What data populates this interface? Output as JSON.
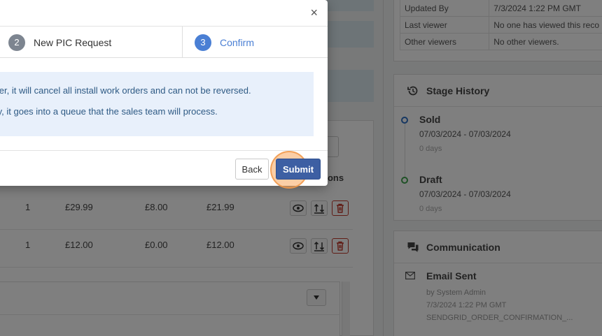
{
  "meta": {
    "rows": [
      {
        "key": "Updated By",
        "value": "7/3/2024 1:22 PM GMT"
      },
      {
        "key": "Last viewer",
        "value": "No one has viewed this reco"
      },
      {
        "key": "Other viewers",
        "value": "No other viewers."
      }
    ]
  },
  "stage_history": {
    "title": "Stage History",
    "stages": [
      {
        "name": "Sold",
        "dates": "07/03/2024 - 07/03/2024",
        "days": "0 days"
      },
      {
        "name": "Draft",
        "dates": "07/03/2024 - 07/03/2024",
        "days": "0 days"
      }
    ]
  },
  "communication": {
    "title": "Communication",
    "item": {
      "title": "Email Sent",
      "by": "by System Admin",
      "time": "7/3/2024 1:22 PM GMT",
      "template": "SENDGRID_ORDER_CONFIRMATION_..."
    }
  },
  "table": {
    "actions_header": "tions",
    "rows": [
      {
        "qty": "1",
        "price": "£29.99",
        "discount": "£8.00",
        "total": "£21.99"
      },
      {
        "qty": "1",
        "price": "£12.00",
        "discount": "£0.00",
        "total": "£12.00"
      }
    ]
  },
  "modal": {
    "close_label": "×",
    "steps": [
      {
        "number": "2",
        "label": "New PIC Request"
      },
      {
        "number": "3",
        "label": "Confirm"
      }
    ],
    "info_lines": [
      "order, it will cancel all install work orders and can not be reversed.",
      "way, it goes into a queue that the sales team will process."
    ],
    "back_label": "Back",
    "submit_label": "Submit"
  },
  "colors": {
    "primary": "#3d5fa3",
    "step_active": "#4a7fd4",
    "step_inactive": "#7d8590",
    "info_bg": "#e8f0fb",
    "info_text": "#2e5a84"
  }
}
